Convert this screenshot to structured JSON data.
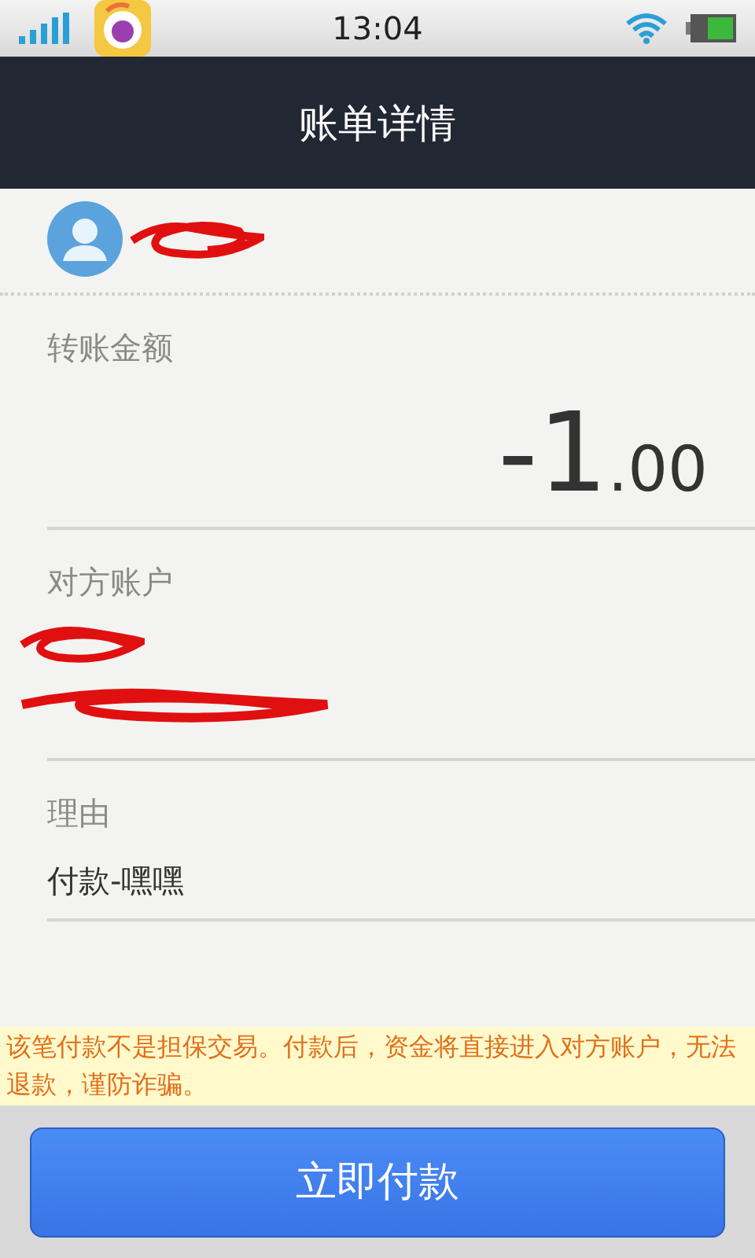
{
  "status_bar": {
    "time": "13:04"
  },
  "header": {
    "title": "账单详情"
  },
  "amount_section": {
    "label": "转账金额",
    "amount_integer": "-1",
    "amount_decimal": ".00"
  },
  "account_section": {
    "label": "对方账户"
  },
  "reason_section": {
    "label": "理由",
    "value": "付款-嘿嘿"
  },
  "notice": "该笔付款不是担保交易。付款后，资金将直接进入对方账户，无法退款，谨防诈骗。",
  "pay_button": "立即付款"
}
